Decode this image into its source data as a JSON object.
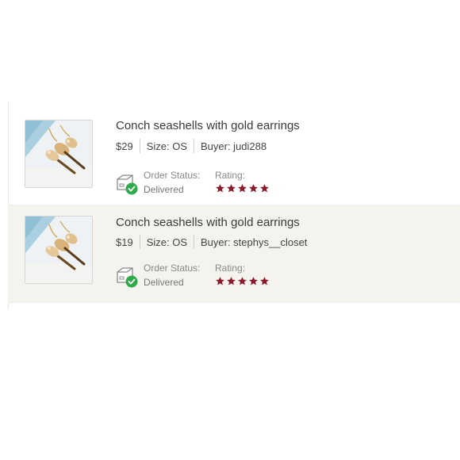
{
  "orders": [
    {
      "title": "Conch seashells with gold earrings",
      "price": "$29",
      "size": "Size: OS",
      "buyer": "Buyer: judi288",
      "status_label": "Order Status:",
      "status_value": "Delivered",
      "rating_label": "Rating:",
      "rating": 5,
      "thumbnail_icon": "earrings-photo",
      "status_icon": "delivered-box-icon"
    },
    {
      "title": "Conch seashells with gold earrings",
      "price": "$19",
      "size": "Size: OS",
      "buyer": "Buyer: stephys__closet",
      "status_label": "Order Status:",
      "status_value": "Delivered",
      "rating_label": "Rating:",
      "rating": 5,
      "thumbnail_icon": "earrings-photo",
      "status_icon": "delivered-box-icon"
    }
  ],
  "colors": {
    "star": "#8b1a2b",
    "check": "#2eaa4a",
    "row_highlight": "#f5f3ee"
  }
}
